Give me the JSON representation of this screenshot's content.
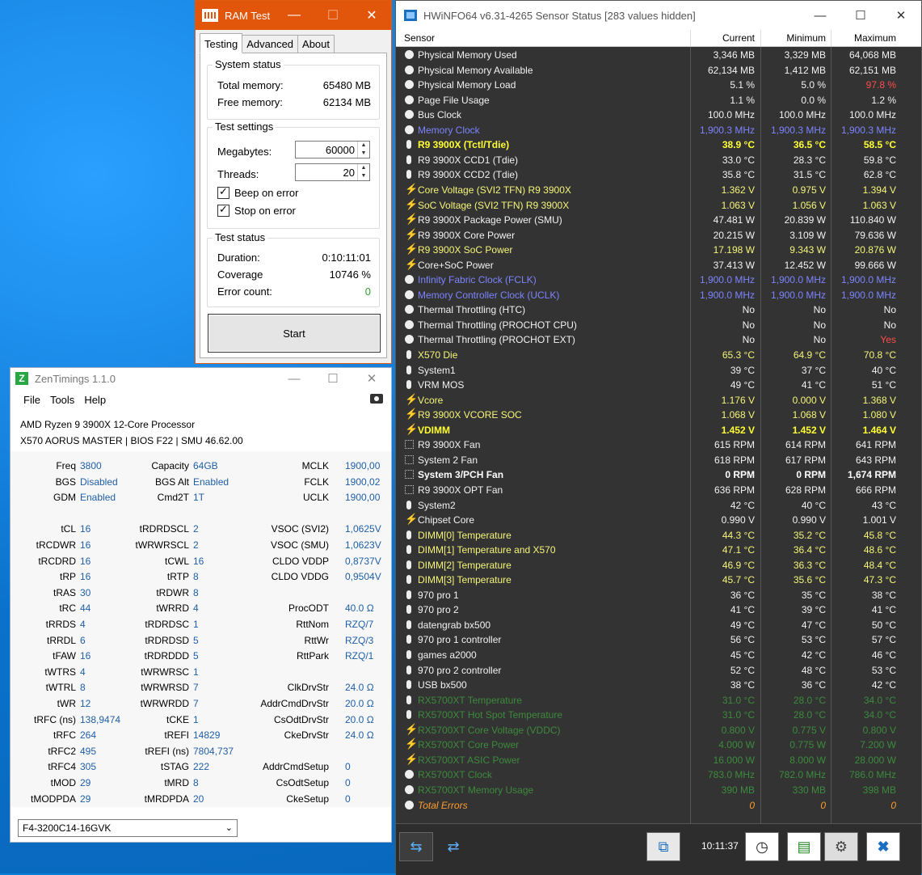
{
  "ramtest": {
    "title": "RAM Test",
    "tabs": [
      "Testing",
      "Advanced",
      "About"
    ],
    "system_status": {
      "legend": "System status",
      "total_label": "Total memory:",
      "total_value": "65480 MB",
      "free_label": "Free memory:",
      "free_value": "62134 MB"
    },
    "test_settings": {
      "legend": "Test settings",
      "megabytes_label": "Megabytes:",
      "megabytes_value": "60000",
      "threads_label": "Threads:",
      "threads_value": "20",
      "beep_label": "Beep on error",
      "stop_label": "Stop on error"
    },
    "test_status": {
      "legend": "Test status",
      "duration_label": "Duration:",
      "duration_value": "0:10:11:01",
      "coverage_label": "Coverage",
      "coverage_value": "10746 %",
      "error_label": "Error count:",
      "error_value": "0"
    },
    "start_label": "Start"
  },
  "zen": {
    "title": "ZenTimings 1.1.0",
    "menu": [
      "File",
      "Tools",
      "Help"
    ],
    "cpu": "AMD Ryzen 9 3900X 12-Core Processor",
    "board": "X570 AORUS MASTER | BIOS F22 | SMU 46.62.00",
    "rows": [
      [
        "Freq",
        "3800",
        "Capacity",
        "64GB",
        "MCLK",
        "1900,00"
      ],
      [
        "BGS",
        "Disabled",
        "BGS Alt",
        "Enabled",
        "FCLK",
        "1900,02"
      ],
      [
        "GDM",
        "Enabled",
        "Cmd2T",
        "1T",
        "UCLK",
        "1900,00"
      ],
      [
        "",
        "",
        "",
        "",
        "",
        ""
      ],
      [
        "tCL",
        "16",
        "tRDRDSCL",
        "2",
        "VSOC (SVI2)",
        "1,0625V"
      ],
      [
        "tRCDWR",
        "16",
        "tWRWRSCL",
        "2",
        "VSOC (SMU)",
        "1,0623V"
      ],
      [
        "tRCDRD",
        "16",
        "tCWL",
        "16",
        "CLDO VDDP",
        "0,8737V"
      ],
      [
        "tRP",
        "16",
        "tRTP",
        "8",
        "CLDO VDDG",
        "0,9504V"
      ],
      [
        "tRAS",
        "30",
        "tRDWR",
        "8",
        "",
        ""
      ],
      [
        "tRC",
        "44",
        "tWRRD",
        "4",
        "ProcODT",
        "40.0 Ω"
      ],
      [
        "tRRDS",
        "4",
        "tRDRDSC",
        "1",
        "RttNom",
        "RZQ/7"
      ],
      [
        "tRRDL",
        "6",
        "tRDRDSD",
        "5",
        "RttWr",
        "RZQ/3"
      ],
      [
        "tFAW",
        "16",
        "tRDRDDD",
        "5",
        "RttPark",
        "RZQ/1"
      ],
      [
        "tWTRS",
        "4",
        "tWRWRSC",
        "1",
        "",
        ""
      ],
      [
        "tWTRL",
        "8",
        "tWRWRSD",
        "7",
        "ClkDrvStr",
        "24.0 Ω"
      ],
      [
        "tWR",
        "12",
        "tWRWRDD",
        "7",
        "AddrCmdDrvStr",
        "20.0 Ω"
      ],
      [
        "tRFC (ns)",
        "138,9474",
        "tCKE",
        "1",
        "CsOdtDrvStr",
        "20.0 Ω"
      ],
      [
        "tRFC",
        "264",
        "tREFI",
        "14829",
        "CkeDrvStr",
        "24.0 Ω"
      ],
      [
        "tRFC2",
        "495",
        "tREFI (ns)",
        "7804,737",
        "",
        ""
      ],
      [
        "tRFC4",
        "305",
        "tSTAG",
        "222",
        "AddrCmdSetup",
        "0"
      ],
      [
        "tMOD",
        "29",
        "tMRD",
        "8",
        "CsOdtSetup",
        "0"
      ],
      [
        "tMODPDA",
        "29",
        "tMRDPDA",
        "20",
        "CkeSetup",
        "0"
      ]
    ],
    "profile": "F4-3200C14-16GVK"
  },
  "hwinfo": {
    "title": "HWiNFO64 v6.31-4265 Sensor Status [283 values hidden]",
    "headers": [
      "Sensor",
      "Current",
      "Minimum",
      "Maximum"
    ],
    "time": "10:11:37",
    "rows": [
      {
        "icon": "clock",
        "name": "Physical Memory Used",
        "cur": "3,346 MB",
        "min": "3,329 MB",
        "max": "64,068 MB",
        "color": "white"
      },
      {
        "icon": "clock",
        "name": "Physical Memory Available",
        "cur": "62,134 MB",
        "min": "1,412 MB",
        "max": "62,151 MB",
        "color": "white"
      },
      {
        "icon": "clock",
        "name": "Physical Memory Load",
        "cur": "5.1 %",
        "min": "5.0 %",
        "max": "97.8 %",
        "color": "white",
        "maxred": true
      },
      {
        "icon": "clock",
        "name": "Page File Usage",
        "cur": "1.1 %",
        "min": "0.0 %",
        "max": "1.2 %",
        "color": "white"
      },
      {
        "icon": "clock",
        "name": "Bus Clock",
        "cur": "100.0 MHz",
        "min": "100.0 MHz",
        "max": "100.0 MHz",
        "color": "white"
      },
      {
        "icon": "clock",
        "name": "Memory Clock",
        "cur": "1,900.3 MHz",
        "min": "1,900.3 MHz",
        "max": "1,900.3 MHz",
        "color": "blue"
      },
      {
        "icon": "temp",
        "name": "R9 3900X (Tctl/Tdie)",
        "cur": "38.9 °C",
        "min": "36.5 °C",
        "max": "58.5 °C",
        "color": "yellowb"
      },
      {
        "icon": "temp",
        "name": "R9 3900X CCD1 (Tdie)",
        "cur": "33.0 °C",
        "min": "28.3 °C",
        "max": "59.8 °C",
        "color": "white"
      },
      {
        "icon": "temp",
        "name": "R9 3900X CCD2 (Tdie)",
        "cur": "35.8 °C",
        "min": "31.5 °C",
        "max": "62.8 °C",
        "color": "white"
      },
      {
        "icon": "volt",
        "name": "Core Voltage (SVI2 TFN) R9 3900X",
        "cur": "1.362 V",
        "min": "0.975 V",
        "max": "1.394 V",
        "color": "yellow"
      },
      {
        "icon": "volt",
        "name": "SoC Voltage (SVI2 TFN) R9 3900X",
        "cur": "1.063 V",
        "min": "1.056 V",
        "max": "1.063 V",
        "color": "yellow"
      },
      {
        "icon": "volt",
        "name": "R9 3900X Package Power (SMU)",
        "cur": "47.481 W",
        "min": "20.839 W",
        "max": "110.840 W",
        "color": "white"
      },
      {
        "icon": "volt",
        "name": "R9 3900X Core Power",
        "cur": "20.215 W",
        "min": "3.109 W",
        "max": "79.636 W",
        "color": "white"
      },
      {
        "icon": "volt",
        "name": "R9 3900X SoC Power",
        "cur": "17.198 W",
        "min": "9.343 W",
        "max": "20.876 W",
        "color": "yellow"
      },
      {
        "icon": "volt",
        "name": "Core+SoC Power",
        "cur": "37.413 W",
        "min": "12.452 W",
        "max": "99.666 W",
        "color": "white"
      },
      {
        "icon": "clock",
        "name": "Infinity Fabric Clock (FCLK)",
        "cur": "1,900.0 MHz",
        "min": "1,900.0 MHz",
        "max": "1,900.0 MHz",
        "color": "blue"
      },
      {
        "icon": "clock",
        "name": "Memory Controller Clock (UCLK)",
        "cur": "1,900.0 MHz",
        "min": "1,900.0 MHz",
        "max": "1,900.0 MHz",
        "color": "blue"
      },
      {
        "icon": "clock",
        "name": "Thermal Throttling (HTC)",
        "cur": "No",
        "min": "No",
        "max": "No",
        "color": "white"
      },
      {
        "icon": "clock",
        "name": "Thermal Throttling (PROCHOT CPU)",
        "cur": "No",
        "min": "No",
        "max": "No",
        "color": "white"
      },
      {
        "icon": "clock",
        "name": "Thermal Throttling (PROCHOT EXT)",
        "cur": "No",
        "min": "No",
        "max": "Yes",
        "color": "white",
        "maxred": true
      },
      {
        "icon": "temp",
        "name": "X570 Die",
        "cur": "65.3 °C",
        "min": "64.9 °C",
        "max": "70.8 °C",
        "color": "yellow"
      },
      {
        "icon": "temp",
        "name": "System1",
        "cur": "39 °C",
        "min": "37 °C",
        "max": "40 °C",
        "color": "white"
      },
      {
        "icon": "temp",
        "name": "VRM MOS",
        "cur": "49 °C",
        "min": "41 °C",
        "max": "51 °C",
        "color": "white"
      },
      {
        "icon": "volt",
        "name": "Vcore",
        "cur": "1.176 V",
        "min": "0.000 V",
        "max": "1.368 V",
        "color": "yellow"
      },
      {
        "icon": "volt",
        "name": "R9 3900X VCORE SOC",
        "cur": "1.068 V",
        "min": "1.068 V",
        "max": "1.080 V",
        "color": "yellow"
      },
      {
        "icon": "volt",
        "name": "VDIMM",
        "cur": "1.452 V",
        "min": "1.452 V",
        "max": "1.464 V",
        "color": "yellowb"
      },
      {
        "icon": "fan",
        "name": "R9 3900X Fan",
        "cur": "615 RPM",
        "min": "614 RPM",
        "max": "641 RPM",
        "color": "white"
      },
      {
        "icon": "fan",
        "name": "System 2 Fan",
        "cur": "618 RPM",
        "min": "617 RPM",
        "max": "643 RPM",
        "color": "white"
      },
      {
        "icon": "fan",
        "name": "System 3/PCH Fan",
        "cur": "0 RPM",
        "min": "0 RPM",
        "max": "1,674 RPM",
        "color": "whiteb"
      },
      {
        "icon": "fan",
        "name": "R9 3900X OPT Fan",
        "cur": "636 RPM",
        "min": "628 RPM",
        "max": "666 RPM",
        "color": "white"
      },
      {
        "icon": "temp",
        "name": "System2",
        "cur": "42 °C",
        "min": "40 °C",
        "max": "43 °C",
        "color": "white"
      },
      {
        "icon": "volt",
        "name": "Chipset Core",
        "cur": "0.990 V",
        "min": "0.990 V",
        "max": "1.001 V",
        "color": "white"
      },
      {
        "icon": "temp",
        "name": "DIMM[0] Temperature",
        "cur": "44.3 °C",
        "min": "35.2 °C",
        "max": "45.8 °C",
        "color": "yellow"
      },
      {
        "icon": "temp",
        "name": "DIMM[1] Temperature and X570",
        "cur": "47.1 °C",
        "min": "36.4 °C",
        "max": "48.6 °C",
        "color": "yellow"
      },
      {
        "icon": "temp",
        "name": "DIMM[2] Temperature",
        "cur": "46.9 °C",
        "min": "36.3 °C",
        "max": "48.4 °C",
        "color": "yellow"
      },
      {
        "icon": "temp",
        "name": "DIMM[3] Temperature",
        "cur": "45.7 °C",
        "min": "35.6 °C",
        "max": "47.3 °C",
        "color": "yellow"
      },
      {
        "icon": "temp",
        "name": "970 pro 1",
        "cur": "36 °C",
        "min": "35 °C",
        "max": "38 °C",
        "color": "white"
      },
      {
        "icon": "temp",
        "name": "970 pro 2",
        "cur": "41 °C",
        "min": "39 °C",
        "max": "41 °C",
        "color": "white"
      },
      {
        "icon": "temp",
        "name": "datengrab bx500",
        "cur": "49 °C",
        "min": "47 °C",
        "max": "50 °C",
        "color": "white"
      },
      {
        "icon": "temp",
        "name": "970 pro 1 controller",
        "cur": "56 °C",
        "min": "53 °C",
        "max": "57 °C",
        "color": "white"
      },
      {
        "icon": "temp",
        "name": "games a2000",
        "cur": "45 °C",
        "min": "42 °C",
        "max": "46 °C",
        "color": "white"
      },
      {
        "icon": "temp",
        "name": "970 pro 2 controller",
        "cur": "52 °C",
        "min": "48 °C",
        "max": "53 °C",
        "color": "white"
      },
      {
        "icon": "temp",
        "name": "USB bx500",
        "cur": "38 °C",
        "min": "36 °C",
        "max": "42 °C",
        "color": "white"
      },
      {
        "icon": "temp",
        "name": "RX5700XT Temperature",
        "cur": "31.0 °C",
        "min": "28.0 °C",
        "max": "34.0 °C",
        "color": "green"
      },
      {
        "icon": "temp",
        "name": "RX5700XT Hot Spot Temperature",
        "cur": "31.0 °C",
        "min": "28.0 °C",
        "max": "34.0 °C",
        "color": "green"
      },
      {
        "icon": "volt",
        "name": "RX5700XT Core Voltage (VDDC)",
        "cur": "0.800 V",
        "min": "0.775 V",
        "max": "0.800 V",
        "color": "green"
      },
      {
        "icon": "volt",
        "name": "RX5700XT Core Power",
        "cur": "4.000 W",
        "min": "0.775 W",
        "max": "7.200 W",
        "color": "green"
      },
      {
        "icon": "volt",
        "name": "RX5700XT ASIC Power",
        "cur": "16.000 W",
        "min": "8.000 W",
        "max": "28.000 W",
        "color": "green"
      },
      {
        "icon": "clock",
        "name": "RX5700XT Clock",
        "cur": "783.0 MHz",
        "min": "782.0 MHz",
        "max": "786.0 MHz",
        "color": "green"
      },
      {
        "icon": "clock",
        "name": "RX5700XT Memory Usage",
        "cur": "390 MB",
        "min": "330 MB",
        "max": "398 MB",
        "color": "green"
      },
      {
        "icon": "clock",
        "name": "Total Errors",
        "cur": "0",
        "min": "0",
        "max": "0",
        "color": "orange"
      }
    ]
  },
  "colors": {
    "ramtest_accent": "#e2560c",
    "desktop": "#0a7fd6",
    "hwinfo_bg": "#333333"
  }
}
